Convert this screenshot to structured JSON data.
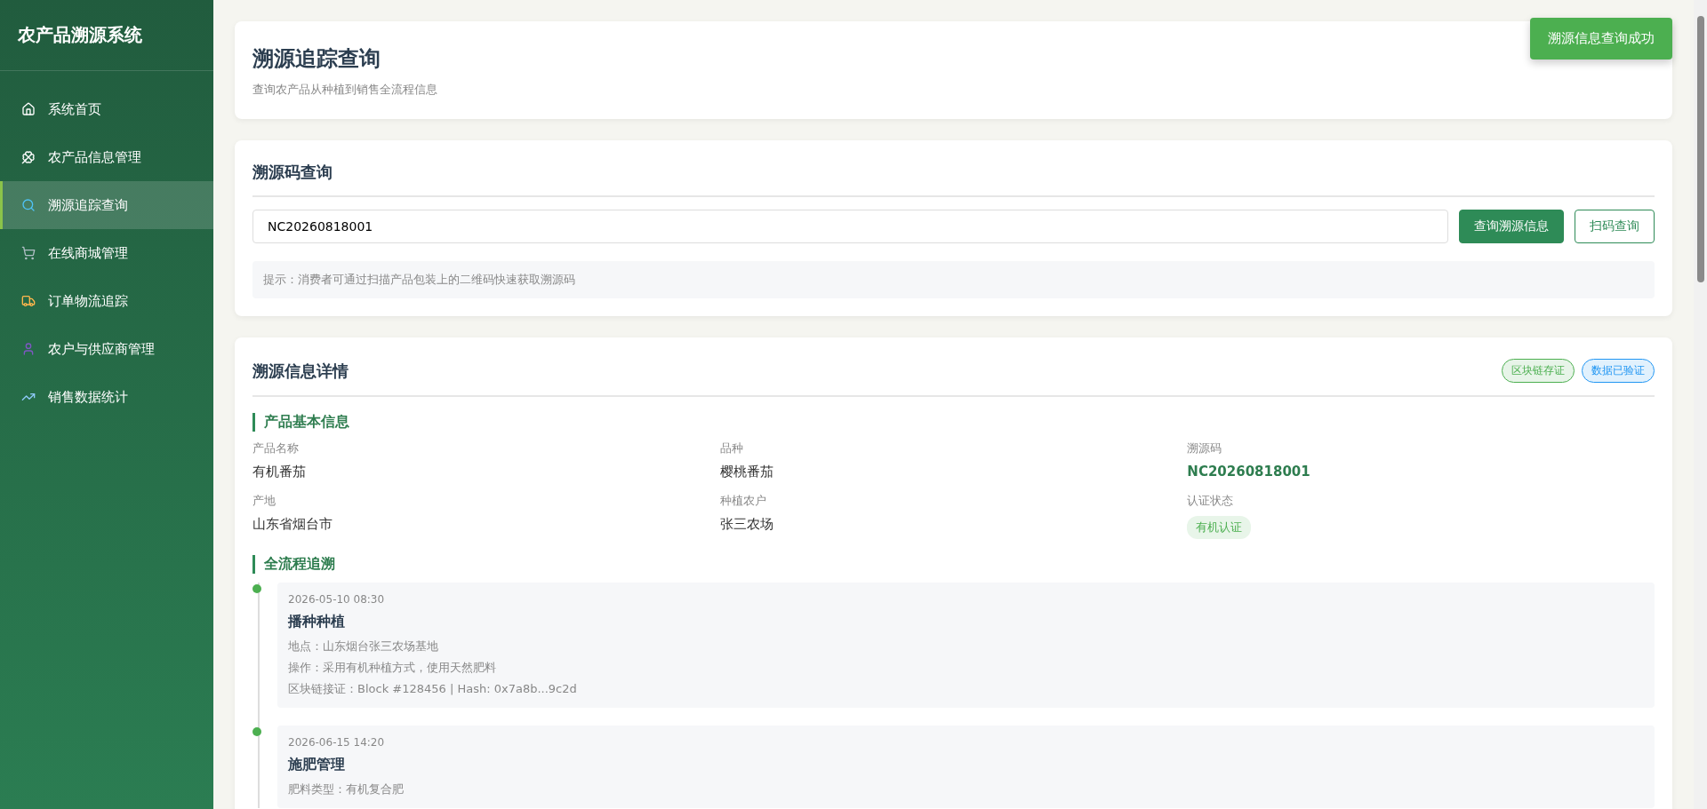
{
  "sidebar": {
    "title": "农产品溯源系统",
    "items": [
      {
        "label": "系统首页",
        "selected": false
      },
      {
        "label": "农产品信息管理",
        "selected": false
      },
      {
        "label": "溯源追踪查询",
        "selected": true
      },
      {
        "label": "在线商城管理",
        "selected": false
      },
      {
        "label": "订单物流追踪",
        "selected": false
      },
      {
        "label": "农户与供应商管理",
        "selected": false
      },
      {
        "label": "销售数据统计",
        "selected": false
      }
    ]
  },
  "header": {
    "title": "溯源追踪查询",
    "subtitle": "查询农产品从种植到销售全流程信息"
  },
  "toast": "溯源信息查询成功",
  "query": {
    "title": "溯源码查询",
    "value": "NC20260818001",
    "buttons": [
      "查询溯源信息",
      "扫码查询"
    ],
    "hint": "提示：消费者可通过扫描产品包装上的二维码快速获取溯源码"
  },
  "details": {
    "title": "溯源信息详情",
    "badges": [
      {
        "label": "区块链存证",
        "color": "#4caf50"
      },
      {
        "label": "数据已验证",
        "color": "#2196f3"
      }
    ],
    "basic_title": "产品基本信息",
    "fields": [
      {
        "label": "产品名称",
        "value": "有机番茄",
        "kind": "text"
      },
      {
        "label": "品种",
        "value": "樱桃番茄",
        "kind": "text"
      },
      {
        "label": "溯源码",
        "value": "NC20260818001",
        "kind": "code"
      },
      {
        "label": "产地",
        "value": "山东省烟台市",
        "kind": "text"
      },
      {
        "label": "种植农户",
        "value": "张三农场",
        "kind": "text"
      },
      {
        "label": "认证状态",
        "value": "有机认证",
        "kind": "tag"
      }
    ],
    "timeline_title": "全流程追溯",
    "timeline": [
      {
        "time": "2026-05-10 08:30",
        "title": "播种种植",
        "lines": [
          "地点：山东烟台张三农场基地",
          "操作：采用有机种植方式，使用天然肥料",
          "区块链接证：Block #128456 | Hash: 0x7a8b...9c2d"
        ]
      },
      {
        "time": "2026-06-15 14:20",
        "title": "施肥管理",
        "lines": [
          "肥料类型：有机复合肥"
        ]
      }
    ]
  }
}
